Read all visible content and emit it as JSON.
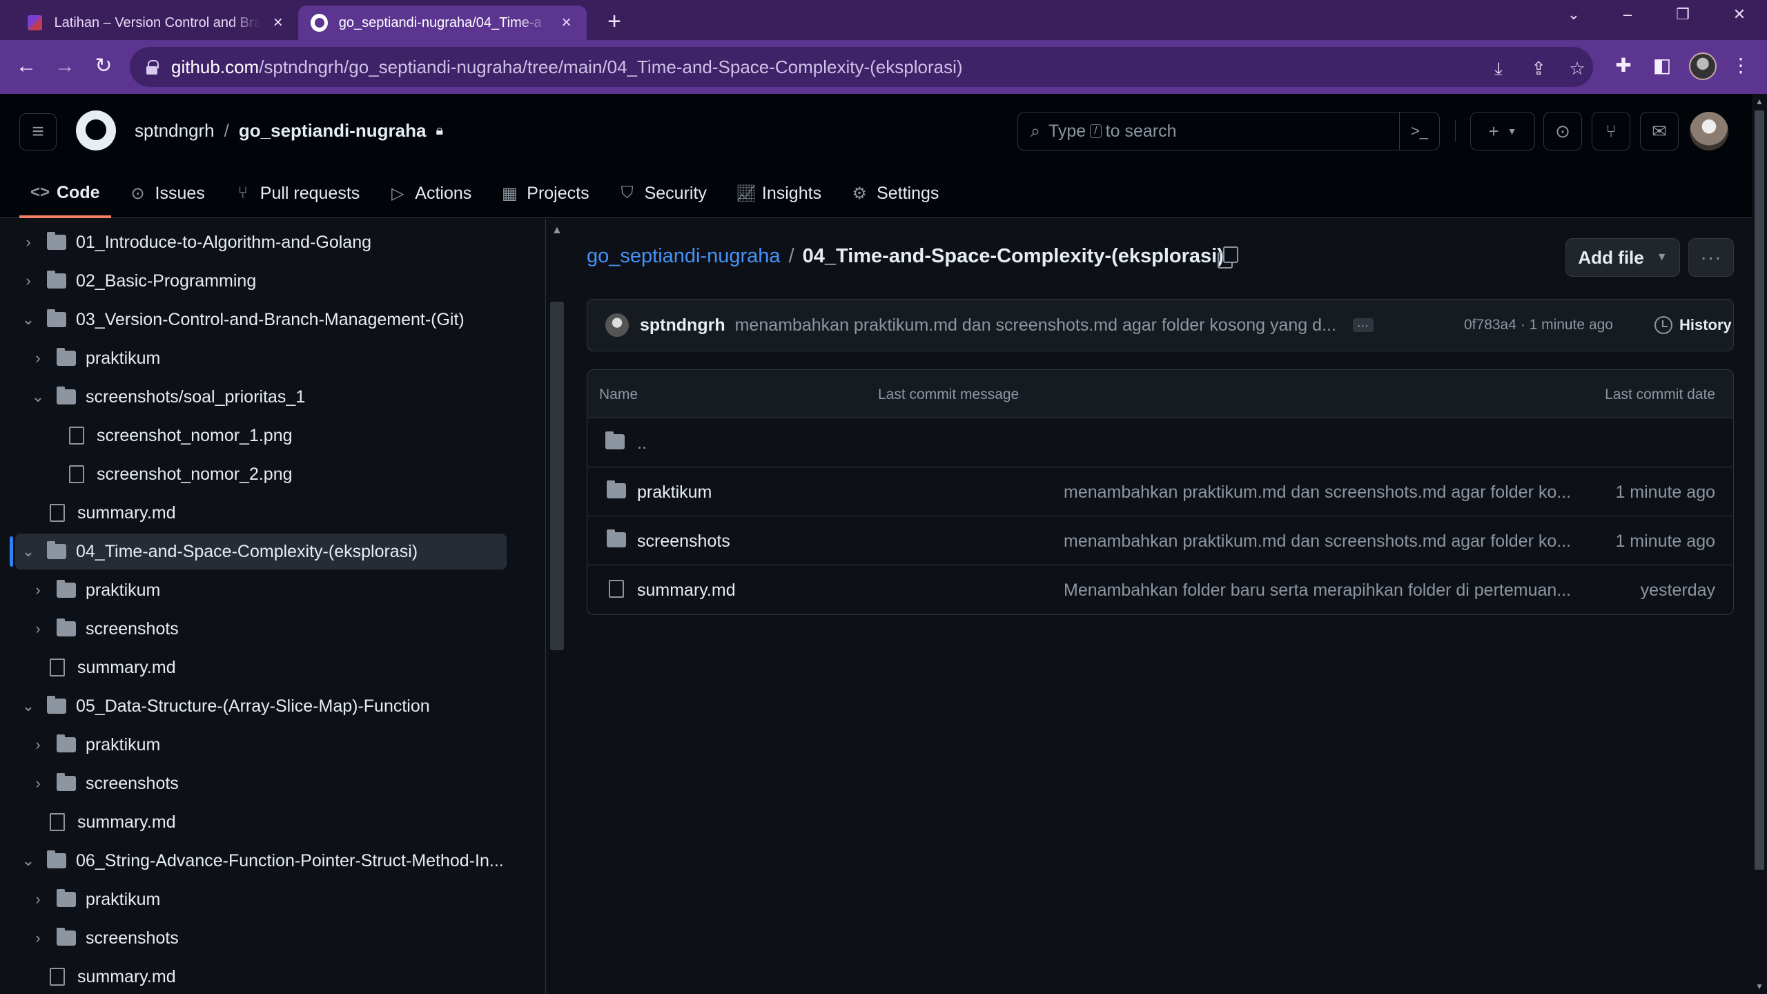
{
  "browser": {
    "tabs": [
      {
        "title": "Latihan – Version Control and Bra",
        "active": false
      },
      {
        "title": "go_septiandi-nugraha/04_Time-a",
        "active": true
      }
    ],
    "new_tab": "+",
    "url_domain": "github.com",
    "url_path": "/sptndngrh/go_septiandi-nugraha/tree/main/04_Time-and-Space-Complexity-(eksplorasi)"
  },
  "header": {
    "owner": "sptndngrh",
    "separator": "/",
    "repo": "go_septiandi-nugraha",
    "search_prefix": "Type",
    "search_key": "/",
    "search_suffix": "to search",
    "create_label": "+"
  },
  "repo_nav": [
    {
      "label": "Code",
      "icon": "code-icon",
      "active": true
    },
    {
      "label": "Issues",
      "icon": "issue-icon",
      "active": false
    },
    {
      "label": "Pull requests",
      "icon": "pull-request-icon",
      "active": false
    },
    {
      "label": "Actions",
      "icon": "play-icon",
      "active": false
    },
    {
      "label": "Projects",
      "icon": "table-icon",
      "active": false
    },
    {
      "label": "Security",
      "icon": "shield-icon",
      "active": false
    },
    {
      "label": "Insights",
      "icon": "graph-icon",
      "active": false
    },
    {
      "label": "Settings",
      "icon": "gear-icon",
      "active": false
    }
  ],
  "tree": [
    {
      "label": "01_Introduce-to-Algorithm-and-Golang",
      "type": "folder",
      "expanded": false,
      "depth": 0
    },
    {
      "label": "02_Basic-Programming",
      "type": "folder",
      "expanded": false,
      "depth": 0
    },
    {
      "label": "03_Version-Control-and-Branch-Management-(Git)",
      "type": "folder",
      "expanded": true,
      "depth": 0
    },
    {
      "label": "praktikum",
      "type": "folder",
      "expanded": false,
      "depth": 1
    },
    {
      "label": "screenshots/soal_prioritas_1",
      "type": "folder",
      "expanded": true,
      "depth": 1
    },
    {
      "label": "screenshot_nomor_1.png",
      "type": "file",
      "depth": 2
    },
    {
      "label": "screenshot_nomor_2.png",
      "type": "file",
      "depth": 2
    },
    {
      "label": "summary.md",
      "type": "file",
      "depth": 1
    },
    {
      "label": "04_Time-and-Space-Complexity-(eksplorasi)",
      "type": "folder",
      "expanded": true,
      "depth": 0,
      "selected": true
    },
    {
      "label": "praktikum",
      "type": "folder",
      "expanded": false,
      "depth": 1
    },
    {
      "label": "screenshots",
      "type": "folder",
      "expanded": false,
      "depth": 1
    },
    {
      "label": "summary.md",
      "type": "file",
      "depth": 1
    },
    {
      "label": "05_Data-Structure-(Array-Slice-Map)-Function",
      "type": "folder",
      "expanded": true,
      "depth": 0
    },
    {
      "label": "praktikum",
      "type": "folder",
      "expanded": false,
      "depth": 1
    },
    {
      "label": "screenshots",
      "type": "folder",
      "expanded": false,
      "depth": 1
    },
    {
      "label": "summary.md",
      "type": "file",
      "depth": 1
    },
    {
      "label": "06_String-Advance-Function-Pointer-Struct-Method-In...",
      "type": "folder",
      "expanded": true,
      "depth": 0
    },
    {
      "label": "praktikum",
      "type": "folder",
      "expanded": false,
      "depth": 1
    },
    {
      "label": "screenshots",
      "type": "folder",
      "expanded": false,
      "depth": 1
    },
    {
      "label": "summary.md",
      "type": "file",
      "depth": 1
    }
  ],
  "breadcrumb": {
    "repo": "go_septiandi-nugraha",
    "sep": "/",
    "current": "04_Time-and-Space-Complexity-(eksplorasi)",
    "trail": "/"
  },
  "actions": {
    "add_file": "Add file",
    "more": "···"
  },
  "latest_commit": {
    "author": "sptndngrh",
    "message": "menambahkan praktikum.md dan screenshots.md agar folder kosong yang d...",
    "ellipsis": "···",
    "meta": "0f783a4 · 1 minute ago",
    "history": "History"
  },
  "file_table": {
    "headers": {
      "name": "Name",
      "message": "Last commit message",
      "date": "Last commit date"
    },
    "parent": "..",
    "rows": [
      {
        "name": "praktikum",
        "type": "folder",
        "message": "menambahkan praktikum.md dan screenshots.md agar folder ko...",
        "date": "1 minute ago"
      },
      {
        "name": "screenshots",
        "type": "folder",
        "message": "menambahkan praktikum.md dan screenshots.md agar folder ko...",
        "date": "1 minute ago"
      },
      {
        "name": "summary.md",
        "type": "file",
        "message": "Menambahkan folder baru serta merapihkan folder di pertemuan...",
        "date": "yesterday"
      }
    ]
  }
}
